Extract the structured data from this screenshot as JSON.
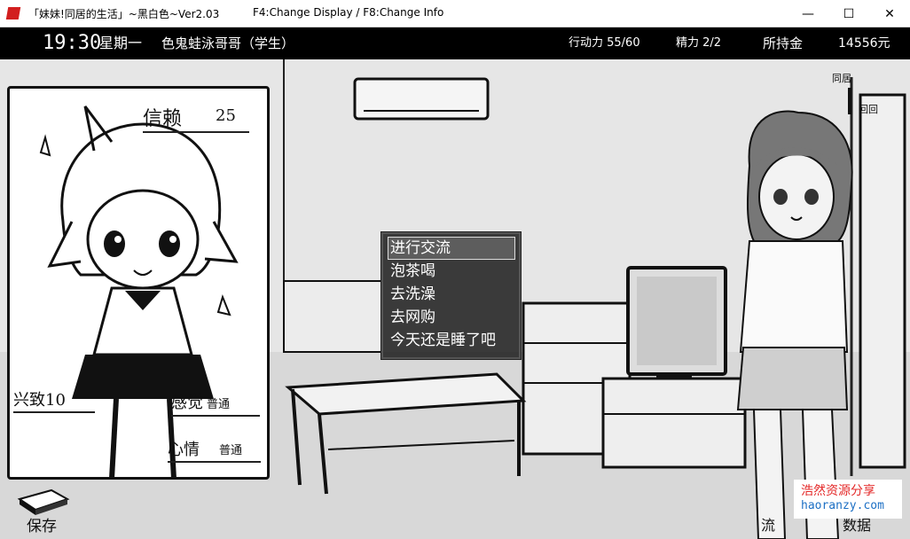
{
  "window": {
    "title": "「妹妹!同居的生活」~黑白色~Ver2.03",
    "info": "F4:Change Display / F8:Change Info",
    "minimize": "—",
    "maximize": "☐",
    "close": "✕"
  },
  "hud": {
    "time": "19:30",
    "weekday": "星期一",
    "player": "色鬼蛙泳哥哥（学生）",
    "action_points": "行动力 55/60",
    "stamina": "精力 2/2",
    "money_label": "所持金",
    "money_value": "14556元"
  },
  "card": {
    "trust_label": "信赖",
    "trust_value": "25",
    "interest": "兴致10",
    "sensation_label": "感觉",
    "sensation_value": "普通",
    "mood_label": "心情",
    "mood_value": "普通"
  },
  "menu": {
    "items": [
      "进行交流",
      "泡茶喝",
      "去洗澡",
      "去网购",
      "今天还是睡了吧"
    ],
    "selected_index": 0
  },
  "bottom": {
    "save": "保存",
    "talk": "流",
    "data": "数据"
  },
  "side": {
    "cohabit": "同居",
    "toggle": "回回"
  },
  "watermark": {
    "cn": "浩然资源分享",
    "en": "haoranzy.com"
  },
  "colors": {
    "hud_bg": "#000000",
    "menu_bg": "#1a1a1a",
    "watermark_cn": "#e42828",
    "watermark_en": "#1c6fc4"
  }
}
